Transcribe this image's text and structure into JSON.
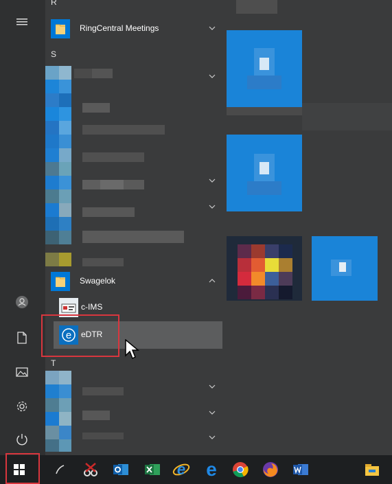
{
  "start_menu": {
    "letters": [
      "R",
      "S",
      "T"
    ],
    "apps": [
      {
        "label": "RingCentral Meetings",
        "icon": "folder-icon"
      },
      {
        "label": "Swagelok",
        "icon": "folder-icon"
      },
      {
        "label": "c-IMS",
        "icon": "c-ims-app-icon"
      },
      {
        "label": "eDTR",
        "icon": "internet-explorer-icon"
      }
    ],
    "rail_icons": [
      "hamburger-menu-icon",
      "user-account-icon",
      "documents-icon",
      "pictures-icon",
      "settings-icon",
      "power-icon"
    ]
  },
  "taskbar": {
    "icons": [
      "start-windows-icon",
      "pen-icon",
      "snipping-tool-icon",
      "outlook-icon",
      "excel-icon",
      "internet-explorer-icon",
      "edge-icon",
      "chrome-icon",
      "firefox-icon",
      "word-icon",
      "file-explorer-icon"
    ]
  },
  "colors": {
    "accent": "#0078d7",
    "highlight_box": "#d9363e",
    "menu_bg": "#3a3b3c",
    "taskbar_bg": "#1d1f21"
  }
}
